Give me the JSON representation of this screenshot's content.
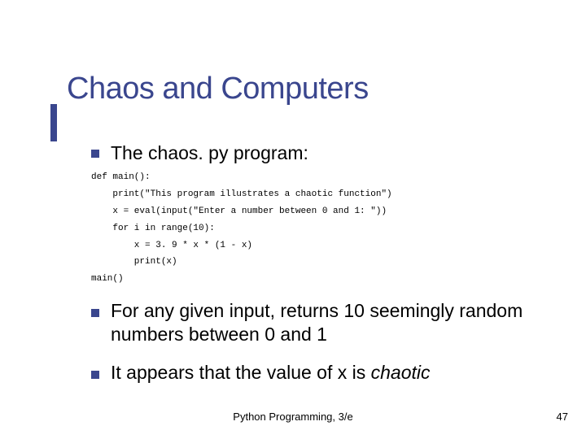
{
  "slide": {
    "title": "Chaos and Computers",
    "bullets": [
      {
        "text": "The chaos. py program:"
      },
      {
        "text": "For any given input, returns 10 seemingly random numbers between 0 and 1"
      },
      {
        "text_pre": "It appears that the value of x is ",
        "text_italic": "chaotic"
      }
    ],
    "code": "def main():\n    print(\"This program illustrates a chaotic function\")\n    x = eval(input(\"Enter a number between 0 and 1: \"))\n    for i in range(10):\n        x = 3. 9 * x * (1 - x)\n        print(x)\nmain()"
  },
  "footer": {
    "book": "Python Programming, 3/e",
    "page": "47"
  }
}
